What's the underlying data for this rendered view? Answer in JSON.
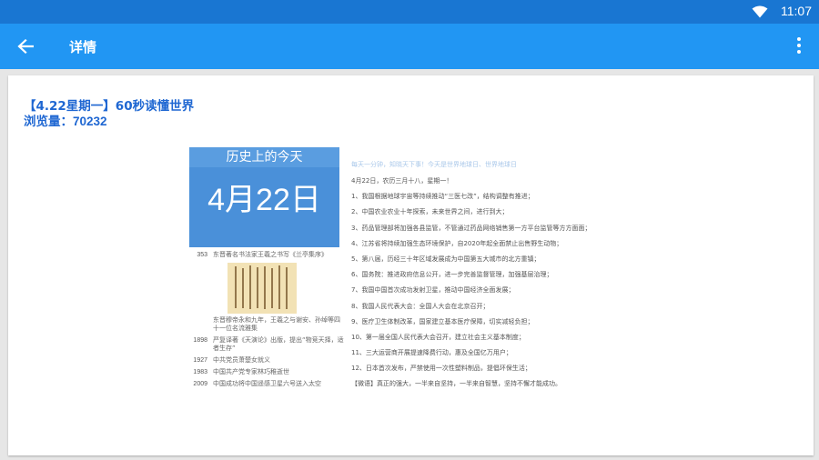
{
  "status_bar": {
    "time": "11:07",
    "icons": [
      "wifi-icon"
    ]
  },
  "app_bar": {
    "title": "详情",
    "back_icon": "back-arrow-icon",
    "more_icon": "more-vert-icon"
  },
  "article": {
    "title": "【4.22星期一】60秒读懂世界",
    "views_label": "浏览量：",
    "views_value": "70232"
  },
  "image": {
    "history_title": "历史上的今天",
    "history_date": "4月22日",
    "history_items": [
      {
        "year": "353",
        "text": "东晋著名书法家王羲之书写《兰亭集序》"
      },
      {
        "year": "",
        "text": "东晋穆帝永和九年，王羲之与谢安、孙绰等四十一位名流雅集"
      },
      {
        "year": "1898",
        "text": "严复译著《天演论》出版，提出“物竞天择，适者生存”"
      },
      {
        "year": "1927",
        "text": "中共党员萧楚女就义"
      },
      {
        "year": "1983",
        "text": "中国共产党专家林巧稚逝世"
      },
      {
        "year": "2009",
        "text": "中国成功将中国遥感卫星六号送入太空"
      }
    ],
    "news_heading": "每天一分钟，知晓天下事！今天是世界地球日、世界地球日",
    "news_lines": [
      "4月22日，农历三月十八，星期一！",
      "1、我国根据地球宇宙等持续推动“三医七改”，结构调整有推进；",
      "2、中国农业农业十年探索，未来世界之间，进行到大；",
      "3、药品管理部将加强各县监管，不管通过药品网络销售第一方平台监管等方方面面；",
      "4、江苏省将持续加强生态环境保护，自2020年起全面禁止出售野生动物；",
      "5、第八届，历经三十年区域发展成为中国第五大城市的北方重镇；",
      "6、国务院：推进政府信息公开，进一步完善监督管理，加强基层治理；",
      "7、我国中国首次成功发射卫星，推动中国经济全面发展；",
      "8、我国人民代表大会：全国人大会在北京召开；",
      "9、医疗卫生体制改革，国家建立基本医疗保障，切实减轻负担；",
      "10、第一届全国人民代表大会召开，建立社会主义基本制度；",
      "11、三大运营商开展提速降费行动，惠及全国亿万用户；",
      "12、日本首次发布，严禁使用一次性塑料制品，提倡环保生活；",
      "【微语】真正的强大，一半来自坚持，一半来自智慧，坚持不懈才能成功。"
    ]
  }
}
